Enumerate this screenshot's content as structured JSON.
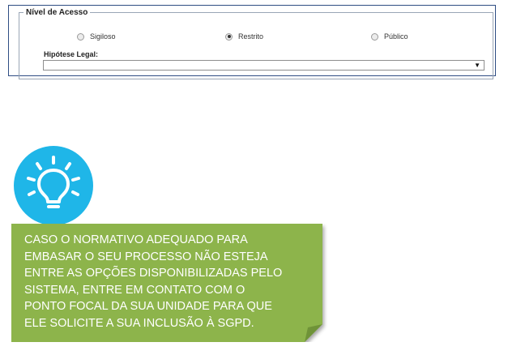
{
  "access_panel": {
    "legend": "Nível de Acesso",
    "options": [
      {
        "label": "Sigiloso",
        "selected": false
      },
      {
        "label": "Restrito",
        "selected": true
      },
      {
        "label": "Público",
        "selected": false
      }
    ],
    "hipotese_label": "Hipótese Legal:",
    "hipotese_value": "",
    "dropdown_icon": "triangle-down-icon"
  },
  "tip": {
    "icon": "lightbulb-icon",
    "icon_color": "#1fb6e8",
    "box_color": "#8db44c",
    "lines": [
      "CASO O NORMATIVO ADEQUADO PARA",
      "EMBASAR O SEU PROCESSO NÃO ESTEJA",
      "ENTRE AS OPÇÕES DISPONIBILIZADAS PELO",
      "SISTEMA, ENTRE EM CONTATO COM O",
      "PONTO FOCAL DA SUA UNIDADE PARA QUE",
      "ELE SOLICITE A SUA INCLUSÃO À SGPD."
    ]
  }
}
